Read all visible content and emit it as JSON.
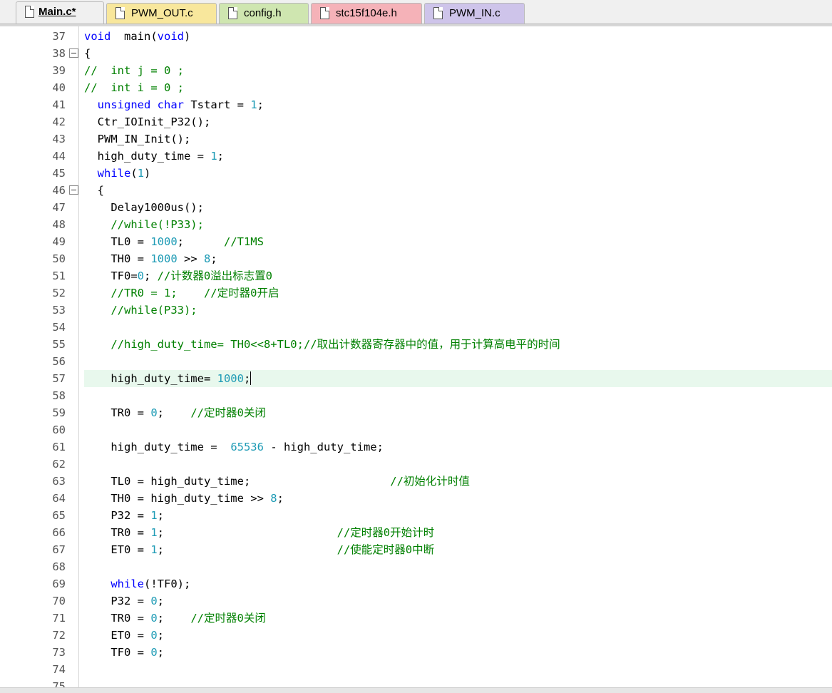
{
  "tabs": [
    {
      "label": "Main.c*",
      "active": true,
      "color": "#f0f0f0"
    },
    {
      "label": "PWM_OUT.c",
      "active": false,
      "color": "#f8e79c"
    },
    {
      "label": "config.h",
      "active": false,
      "color": "#cfe6b0"
    },
    {
      "label": "stc15f104e.h",
      "active": false,
      "color": "#f5b2b8"
    },
    {
      "label": "PWM_IN.c",
      "active": false,
      "color": "#cec4ea"
    }
  ],
  "editor": {
    "current_line": 57,
    "colors": {
      "keyword": "#0000ff",
      "number": "#1e9bb5",
      "comment": "#008000",
      "current_line_bg": "#e8f8ed"
    },
    "lines": [
      {
        "n": "37",
        "fold": false,
        "tokens": [
          [
            "kw",
            "void"
          ],
          [
            "",
            "  main("
          ],
          [
            "kw",
            "void"
          ],
          [
            "",
            ")"
          ]
        ]
      },
      {
        "n": "38",
        "fold": true,
        "tokens": [
          [
            "",
            "{"
          ]
        ]
      },
      {
        "n": "39",
        "fold": false,
        "tokens": [
          [
            "cm",
            "//  int j = 0 ;"
          ]
        ]
      },
      {
        "n": "40",
        "fold": false,
        "tokens": [
          [
            "cm",
            "//  int i = 0 ;"
          ]
        ]
      },
      {
        "n": "41",
        "fold": false,
        "tokens": [
          [
            "",
            "  "
          ],
          [
            "kw",
            "unsigned char"
          ],
          [
            "",
            " Tstart = "
          ],
          [
            "num",
            "1"
          ],
          [
            "",
            ";"
          ]
        ]
      },
      {
        "n": "42",
        "fold": false,
        "tokens": [
          [
            "",
            "  Ctr_IOInit_P32();"
          ]
        ]
      },
      {
        "n": "43",
        "fold": false,
        "tokens": [
          [
            "",
            "  PWM_IN_Init();"
          ]
        ]
      },
      {
        "n": "44",
        "fold": false,
        "tokens": [
          [
            "",
            "  high_duty_time = "
          ],
          [
            "num",
            "1"
          ],
          [
            "",
            ";"
          ]
        ]
      },
      {
        "n": "45",
        "fold": false,
        "tokens": [
          [
            "",
            "  "
          ],
          [
            "kw",
            "while"
          ],
          [
            "",
            "("
          ],
          [
            "num",
            "1"
          ],
          [
            "",
            ")"
          ]
        ]
      },
      {
        "n": "46",
        "fold": true,
        "tokens": [
          [
            "",
            "  {"
          ]
        ]
      },
      {
        "n": "47",
        "fold": false,
        "tokens": [
          [
            "",
            "    Delay1000us();"
          ]
        ]
      },
      {
        "n": "48",
        "fold": false,
        "tokens": [
          [
            "cm",
            "    //while(!P33);"
          ]
        ]
      },
      {
        "n": "49",
        "fold": false,
        "tokens": [
          [
            "",
            "    TL0 = "
          ],
          [
            "num",
            "1000"
          ],
          [
            "",
            ";      "
          ],
          [
            "cm",
            "//T1MS"
          ]
        ]
      },
      {
        "n": "50",
        "fold": false,
        "tokens": [
          [
            "",
            "    TH0 = "
          ],
          [
            "num",
            "1000"
          ],
          [
            "",
            " >> "
          ],
          [
            "num",
            "8"
          ],
          [
            "",
            ";"
          ]
        ]
      },
      {
        "n": "51",
        "fold": false,
        "tokens": [
          [
            "",
            "    TF0="
          ],
          [
            "num",
            "0"
          ],
          [
            "",
            "; "
          ],
          [
            "cm",
            "//计数器0溢出标志置0"
          ]
        ]
      },
      {
        "n": "52",
        "fold": false,
        "tokens": [
          [
            "cm",
            "    //TR0 = 1;    //定时器0开启"
          ]
        ]
      },
      {
        "n": "53",
        "fold": false,
        "tokens": [
          [
            "cm",
            "    //while(P33);"
          ]
        ]
      },
      {
        "n": "54",
        "fold": false,
        "tokens": []
      },
      {
        "n": "55",
        "fold": false,
        "tokens": [
          [
            "cm",
            "    //high_duty_time= TH0<<8+TL0;//取出计数器寄存器中的值，用于计算高电平的时间"
          ]
        ]
      },
      {
        "n": "56",
        "fold": false,
        "tokens": []
      },
      {
        "n": "57",
        "fold": false,
        "tokens": [
          [
            "",
            "    high_duty_time= "
          ],
          [
            "num",
            "1000"
          ],
          [
            "",
            ";"
          ],
          [
            "caret",
            ""
          ]
        ]
      },
      {
        "n": "58",
        "fold": false,
        "tokens": []
      },
      {
        "n": "59",
        "fold": false,
        "tokens": [
          [
            "",
            "    TR0 = "
          ],
          [
            "num",
            "0"
          ],
          [
            "",
            ";    "
          ],
          [
            "cm",
            "//定时器0关闭"
          ]
        ]
      },
      {
        "n": "60",
        "fold": false,
        "tokens": []
      },
      {
        "n": "61",
        "fold": false,
        "tokens": [
          [
            "",
            "    high_duty_time =  "
          ],
          [
            "num",
            "65536"
          ],
          [
            "",
            " - high_duty_time;"
          ]
        ]
      },
      {
        "n": "62",
        "fold": false,
        "tokens": []
      },
      {
        "n": "63",
        "fold": false,
        "tokens": [
          [
            "",
            "    TL0 = high_duty_time;                     "
          ],
          [
            "cm",
            "//初始化计时值"
          ]
        ]
      },
      {
        "n": "64",
        "fold": false,
        "tokens": [
          [
            "",
            "    TH0 = high_duty_time >> "
          ],
          [
            "num",
            "8"
          ],
          [
            "",
            ";"
          ]
        ]
      },
      {
        "n": "65",
        "fold": false,
        "tokens": [
          [
            "",
            "    P32 = "
          ],
          [
            "num",
            "1"
          ],
          [
            "",
            ";"
          ]
        ]
      },
      {
        "n": "66",
        "fold": false,
        "tokens": [
          [
            "",
            "    TR0 = "
          ],
          [
            "num",
            "1"
          ],
          [
            "",
            ";                          "
          ],
          [
            "cm",
            "//定时器0开始计时"
          ]
        ]
      },
      {
        "n": "67",
        "fold": false,
        "tokens": [
          [
            "",
            "    ET0 = "
          ],
          [
            "num",
            "1"
          ],
          [
            "",
            ";                          "
          ],
          [
            "cm",
            "//使能定时器0中断"
          ]
        ]
      },
      {
        "n": "68",
        "fold": false,
        "tokens": []
      },
      {
        "n": "69",
        "fold": false,
        "tokens": [
          [
            "",
            "    "
          ],
          [
            "kw",
            "while"
          ],
          [
            "",
            "(!TF0);"
          ]
        ]
      },
      {
        "n": "70",
        "fold": false,
        "tokens": [
          [
            "",
            "    P32 = "
          ],
          [
            "num",
            "0"
          ],
          [
            "",
            ";"
          ]
        ]
      },
      {
        "n": "71",
        "fold": false,
        "tokens": [
          [
            "",
            "    TR0 = "
          ],
          [
            "num",
            "0"
          ],
          [
            "",
            ";    "
          ],
          [
            "cm",
            "//定时器0关闭"
          ]
        ]
      },
      {
        "n": "72",
        "fold": false,
        "tokens": [
          [
            "",
            "    ET0 = "
          ],
          [
            "num",
            "0"
          ],
          [
            "",
            ";"
          ]
        ]
      },
      {
        "n": "73",
        "fold": false,
        "tokens": [
          [
            "",
            "    TF0 = "
          ],
          [
            "num",
            "0"
          ],
          [
            "",
            ";"
          ]
        ]
      },
      {
        "n": "74",
        "fold": false,
        "tokens": []
      },
      {
        "n": "75",
        "fold": false,
        "tokens": []
      }
    ]
  }
}
